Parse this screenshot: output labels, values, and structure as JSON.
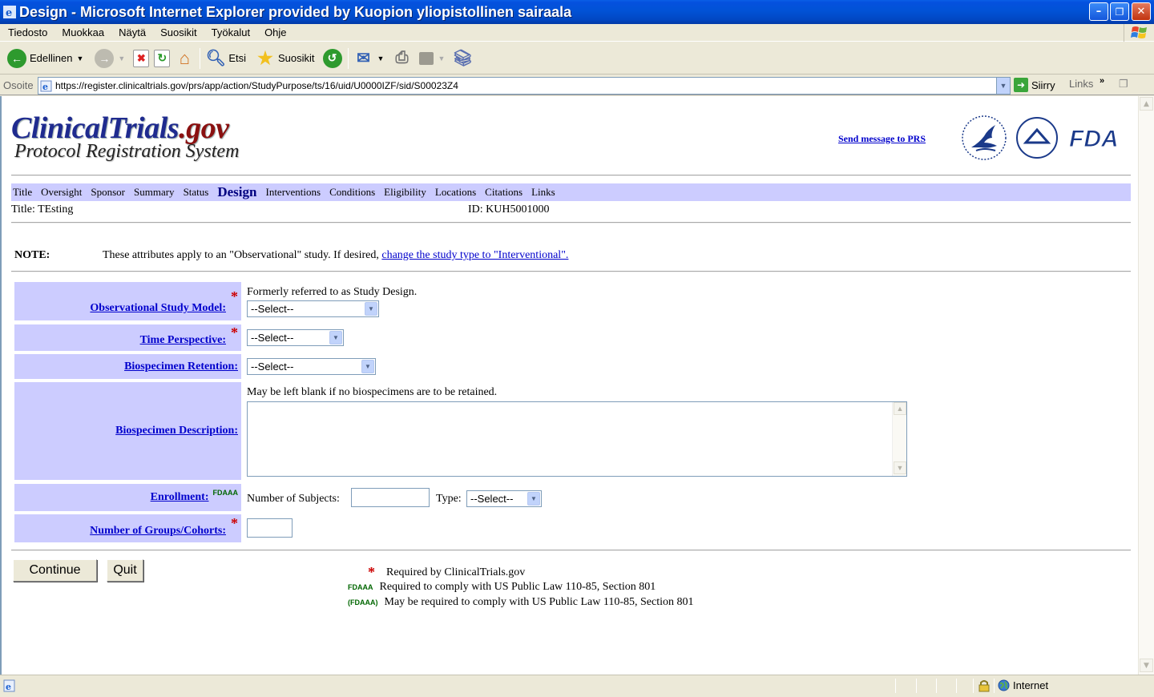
{
  "window": {
    "title": "Design - Microsoft Internet Explorer provided by Kuopion yliopistollinen sairaala",
    "min_glyph": "–",
    "max_glyph": "❐",
    "close_glyph": "✕"
  },
  "menubar": {
    "items": [
      "Tiedosto",
      "Muokkaa",
      "Näytä",
      "Suosikit",
      "Työkalut",
      "Ohje"
    ]
  },
  "toolbar": {
    "back_label": "Edellinen",
    "search_label": "Etsi",
    "favorites_label": "Suosikit"
  },
  "addressbar": {
    "label": "Osoite",
    "url": "https://register.clinicaltrials.gov/prs/app/action/StudyPurpose/ts/16/uid/U0000IZF/sid/S00023Z4",
    "go_label": "Siirry",
    "links_label": "Links",
    "more": "»"
  },
  "header": {
    "logo_main": "ClinicalTrials",
    "logo_gov": ".gov",
    "logo_sub": "Protocol Registration System",
    "send_message": "Send message to PRS",
    "fda_text": "FDA"
  },
  "nav": {
    "items": [
      "Title",
      "Oversight",
      "Sponsor",
      "Summary",
      "Status",
      "Design",
      "Interventions",
      "Conditions",
      "Eligibility",
      "Locations",
      "Citations",
      "Links"
    ],
    "active": "Design"
  },
  "record": {
    "title": "Title: TEsting",
    "id": "ID: KUH5001000"
  },
  "note": {
    "label": "NOTE:",
    "text": "These attributes apply to an \"Observational\" study. If desired, ",
    "link": "change the study type to \"Interventional\"."
  },
  "form": {
    "study_model": {
      "label": "Observational Study Model:",
      "hint": "Formerly referred to as Study Design.",
      "value": "--Select--"
    },
    "time_perspective": {
      "label": "Time Perspective:",
      "value": "--Select--"
    },
    "bio_retention": {
      "label": "Biospecimen Retention:",
      "value": "--Select--"
    },
    "bio_description": {
      "label": "Biospecimen Description:",
      "hint": "May be left blank if no biospecimens are to be retained.",
      "value": ""
    },
    "enrollment": {
      "label": "Enrollment:",
      "tag": "FDAAA",
      "subjects_label": "Number of Subjects:",
      "subjects_value": "",
      "type_label": "Type:",
      "type_value": "--Select--"
    },
    "groups": {
      "label": "Number of Groups/Cohorts:",
      "value": ""
    },
    "required_mark": "*"
  },
  "buttons": {
    "continue": "Continue",
    "quit": "Quit"
  },
  "legend": {
    "required_mark": "*",
    "required_text": "Required by ClinicalTrials.gov",
    "fdaaa_tag": "FDAAA",
    "fdaaa_text": "Required to comply with US Public Law 110-85, Section 801",
    "fdaaa_opt_tag": "(FDAAA)",
    "fdaaa_opt_text": "May be required to comply with US Public Law 110-85, Section 801"
  },
  "statusbar": {
    "zone": "Internet"
  },
  "colors": {
    "nav_bg": "#CCCCFF",
    "link": "#0000CC",
    "required": "#CC0000",
    "fdaaa": "#006600",
    "titlebar": "#0152D6"
  }
}
